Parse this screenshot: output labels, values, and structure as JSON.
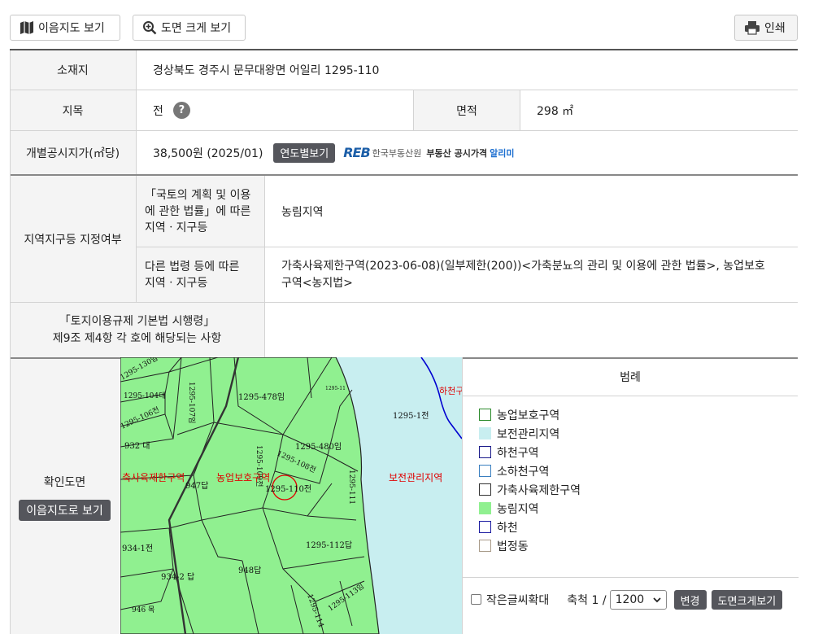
{
  "toolbar": {
    "map_label": "이음지도 보기",
    "zoom_label": "도면 크게 보기",
    "print_label": "인쇄"
  },
  "table": {
    "location_label": "소재지",
    "location_value": "경상북도 경주시 문무대왕면 어일리 1295-110",
    "land_category_label": "지목",
    "land_category_value": "전",
    "help_mark": "?",
    "area_label": "면적",
    "area_value": "298 ㎡",
    "price_label": "개별공시지가(㎡당)",
    "price_value": "38,500원 (2025/01)",
    "price_by_year_button": "연도별보기",
    "reb_logo": "REB",
    "reb_org": "한국부동산원",
    "reb_service_a": "부동산 공시가격",
    "reb_service_b": "알리미",
    "zone_label": "지역지구등 지정여부",
    "zone_sub1_label_l1": "「국토의 계획 및 이용",
    "zone_sub1_label_l2": "에 관한 법률」에 따른",
    "zone_sub1_label_l3": "지역ㆍ지구등",
    "zone_sub1_value": "농림지역",
    "zone_sub2_label_l1": "다른 법령 등에 따른",
    "zone_sub2_label_l2": "지역ㆍ지구등",
    "zone_sub2_value_l1": "가축사육제한구역(2023-06-08)(일부제한(200))<가축분뇨의 관리 및 이용에 관한 법률>, 농업보호",
    "zone_sub2_value_l2": "구역<농지법>",
    "regulation_label_l1": "「토지이용규제 기본법 시행령」",
    "regulation_label_l2": "제9조 제4항 각 호에 해당되는 사항",
    "regulation_value": "",
    "check_map_label": "확인도면",
    "check_map_button": "이음지도로 보기"
  },
  "map": {
    "labels": {
      "p1": "1295-130임",
      "p2": "1295-104대",
      "p3": "1295-107임",
      "p4": "1295-478임",
      "p5": "1295-1전",
      "p6": "1295-106전",
      "p7": "932 대",
      "p8": "1295-480임",
      "p9": "1295-109전",
      "p10": "1295-108전",
      "p11": "947답",
      "p12": "1295-110전",
      "p13": "1295-111",
      "p14": "934-1전",
      "p15": "1295-112답",
      "p16": "934-2 답",
      "p17": "948답",
      "p18": "946 목",
      "p19": "1295-113임",
      "p20": "1295-114",
      "p21": "1295-11",
      "zone_livestock": "축사육제한구역",
      "zone_agri": "농업보호구역",
      "zone_conserve": "보전관리지역",
      "zone_river": "하천구"
    },
    "colors": {
      "agri_fill": "#90f090",
      "conserve_fill": "#c8eef0",
      "zone_text": "#e00000",
      "river_line": "#0000d0"
    }
  },
  "legend": {
    "title": "범례",
    "items": [
      {
        "label": "농업보호구역",
        "border": "#2a8a2a",
        "fill": "#ffffff"
      },
      {
        "label": "보전관리지역",
        "border": "#c8eef0",
        "fill": "#c8eef0"
      },
      {
        "label": "하천구역",
        "border": "#1a1a8a",
        "fill": "#ffffff"
      },
      {
        "label": "소하천구역",
        "border": "#3a7fc0",
        "fill": "#ffffff"
      },
      {
        "label": "가축사육제한구역",
        "border": "#333333",
        "fill": "#ffffff"
      },
      {
        "label": "농림지역",
        "border": "#90f090",
        "fill": "#90f090"
      },
      {
        "label": "하천",
        "border": "#1a1aa0",
        "fill": "#ffffff"
      },
      {
        "label": "법정동",
        "border": "#a89a88",
        "fill": "#ffffff"
      }
    ],
    "small_text_label": "작은글씨확대",
    "scale_label": "축척 1 /",
    "scale_value": "1200",
    "change_button": "변경",
    "big_map_button": "도면크게보기"
  }
}
